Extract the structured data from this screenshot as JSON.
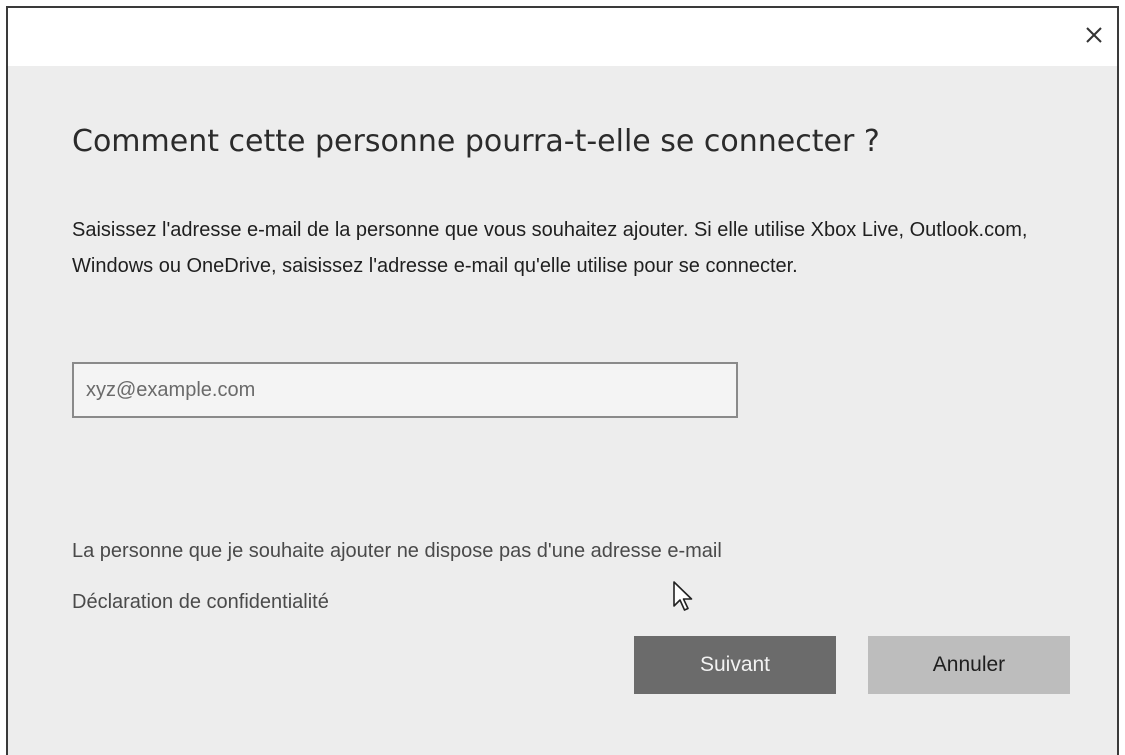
{
  "dialog": {
    "close_icon": "close-icon",
    "title": "Comment cette personne pourra-t-elle se connecter ?",
    "description": "Saisissez l'adresse e-mail de la personne que vous souhaitez ajouter. Si elle utilise Xbox Live, Outlook.com, Windows ou OneDrive, saisissez l'adresse e-mail qu'elle utilise pour se connecter.",
    "email_field": {
      "value": "",
      "placeholder": "xyz@example.com"
    },
    "links": {
      "no_email": "La personne que je souhaite ajouter ne dispose pas d'une adresse e-mail",
      "privacy": "Déclaration de confidentialité"
    },
    "buttons": {
      "next": "Suivant",
      "cancel": "Annuler"
    }
  }
}
